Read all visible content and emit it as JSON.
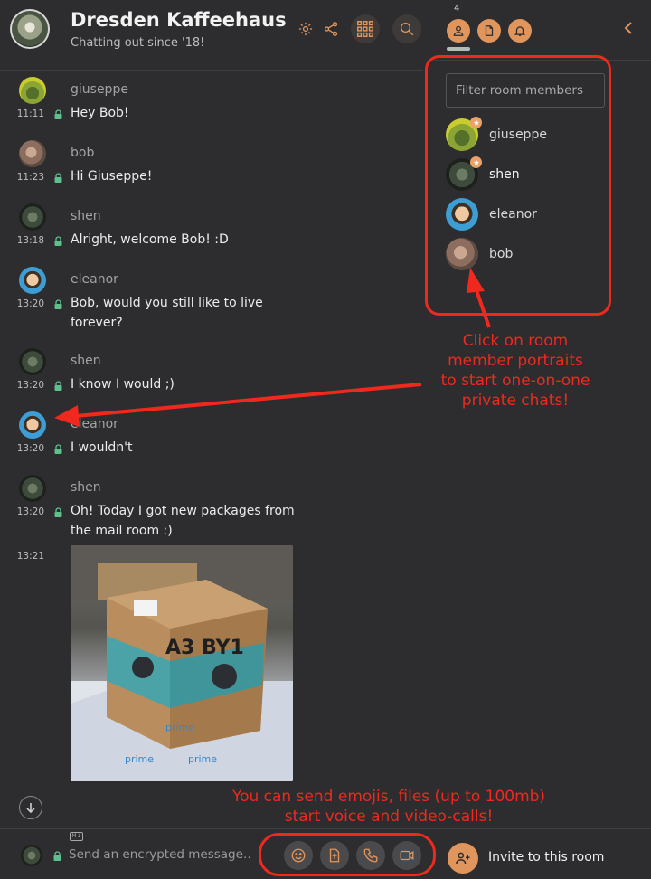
{
  "header": {
    "room_name": "Dresden Kaffeehaus",
    "room_topic": "Chatting out since '18!",
    "member_count": "4"
  },
  "timeline": [
    {
      "sender": "giuseppe",
      "time": "11:11",
      "lines": [
        "Hey Bob!"
      ],
      "avatar": "giuseppe"
    },
    {
      "sender": "bob",
      "time": "11:23",
      "lines": [
        "Hi Giuseppe!"
      ],
      "avatar": "bob"
    },
    {
      "sender": "shen",
      "time": "13:18",
      "lines": [
        "Alright, welcome Bob! :D"
      ],
      "avatar": "shen"
    },
    {
      "sender": "eleanor",
      "time": "13:20",
      "lines": [
        "Bob, would you still like to live",
        "forever?"
      ],
      "avatar": "eleanor"
    },
    {
      "sender": "shen",
      "time": "13:20",
      "lines": [
        "I know I would ;)"
      ],
      "avatar": "shen"
    },
    {
      "sender": "eleanor",
      "time": "13:20",
      "lines": [
        "I wouldn't"
      ],
      "avatar": "eleanor"
    },
    {
      "sender": "shen",
      "time": "13:20",
      "lines": [
        "Oh! Today I got new packages from",
        "the mail room :)"
      ],
      "avatar": "shen"
    },
    {
      "sender": "",
      "time": "13:21",
      "lines": [],
      "avatar": ""
    }
  ],
  "photo": {
    "box_text": "A3 BY1",
    "label_texts": [
      "prime",
      "prime",
      "prime"
    ]
  },
  "right_panel": {
    "filter_placeholder": "Filter room members",
    "members": [
      {
        "name": "giuseppe",
        "avatar": "giuseppe",
        "badge": true
      },
      {
        "name": "shen",
        "avatar": "shen",
        "badge": true
      },
      {
        "name": "eleanor",
        "avatar": "eleanor",
        "badge": false
      },
      {
        "name": "bob",
        "avatar": "bob",
        "badge": false
      }
    ]
  },
  "annotations": {
    "portraits": [
      "Click on room",
      "member portraits",
      "to start one-on-one",
      "private chats!"
    ],
    "composer": [
      "You can send emojis, files (up to 100mb)",
      "start voice and video-calls!"
    ]
  },
  "composer": {
    "placeholder": "Send an encrypted message…",
    "markdown_badge": "M↓",
    "invite_label": "Invite to this room"
  },
  "colors": {
    "accent": "#e0955c",
    "annotation": "#f0281e",
    "encrypted_lock": "#5fbf8f"
  }
}
